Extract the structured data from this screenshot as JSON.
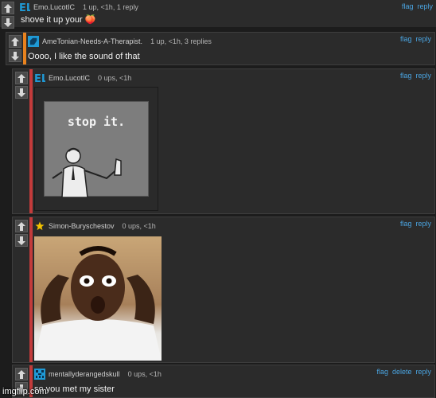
{
  "comments": [
    {
      "username": "Emo.LucotIC",
      "stats": "1 up, <1h, 1 reply",
      "text": "shove it up your 🍑",
      "actions": [
        "flag",
        "reply"
      ]
    },
    {
      "username": "AmeTonian-Needs-A-Therapist.",
      "stats": "1 up, <1h, 3 replies",
      "text": "Oooo, I like the sound of that",
      "actions": [
        "flag",
        "reply"
      ]
    },
    {
      "username": "Emo.LucotIC",
      "stats": "0 ups, <1h",
      "image_caption": "stop it.",
      "actions": [
        "flag",
        "reply"
      ]
    },
    {
      "username": "Simon-Buryschestov",
      "stats": "0 ups, <1h",
      "actions": [
        "flag",
        "reply"
      ]
    },
    {
      "username": "mentallyderangedskull",
      "stats": "0 ups, <1h",
      "text": "so you met my sister",
      "actions": [
        "flag",
        "delete",
        "reply"
      ]
    }
  ],
  "watermark": "imgflip.com",
  "colors": {
    "link": "#4aa3df",
    "bar_orange": "#e8821e",
    "bar_red": "#c33b3b",
    "avatar_blue": "#1f9ad6"
  }
}
